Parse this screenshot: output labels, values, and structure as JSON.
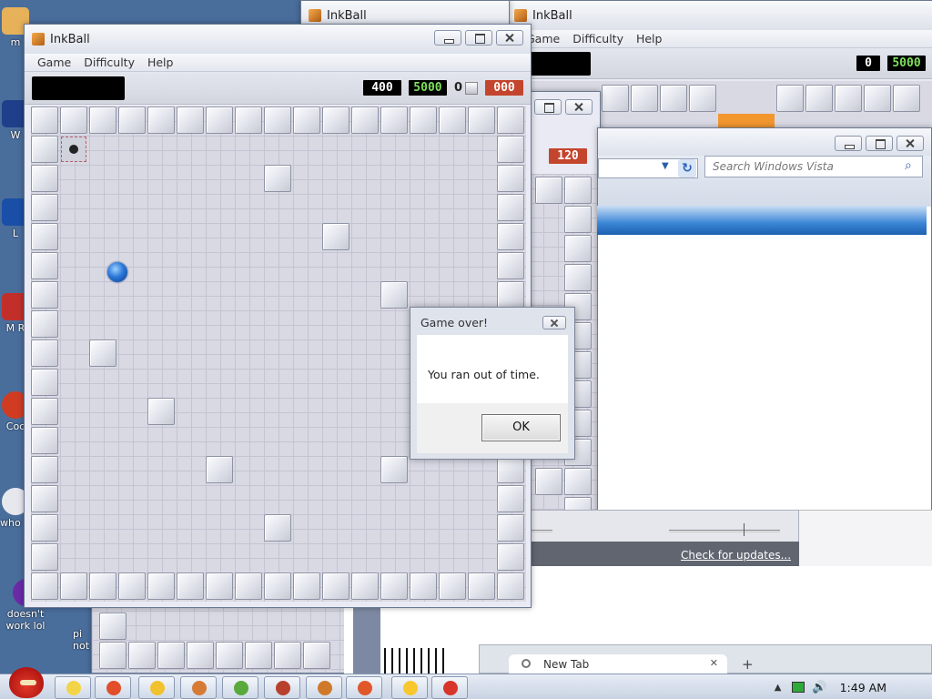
{
  "desktop": {
    "icons": [
      {
        "label": "m",
        "color": "#e7b15a"
      },
      {
        "label": "W",
        "color": "#1f3f8a"
      },
      {
        "label": "L",
        "color": "#1a4fa8"
      },
      {
        "label": "M R",
        "color": "#c22f2a"
      },
      {
        "label": "Coc",
        "color": "#d03c22"
      },
      {
        "label": "who us",
        "color": "#e7e7ee"
      },
      {
        "label": "doesn't work lol",
        "color": "#6b2aa8"
      }
    ],
    "partial_text_behind": "pi not"
  },
  "back_window_right": {
    "title": "InkBall",
    "menu": [
      "Game",
      "Difficulty",
      "Help"
    ],
    "score_left": "0",
    "score_right": "5000"
  },
  "back_window_mid": {
    "title": "InkBall",
    "timer": "120"
  },
  "browser_window": {
    "search_placeholder": "Search Windows Vista",
    "link_text": "Check for updates..."
  },
  "new_tab": {
    "label": "New Tab",
    "close_glyph": "✕",
    "plus_glyph": "+"
  },
  "inkball": {
    "title": "InkBall",
    "menu": [
      "Game",
      "Difficulty",
      "Help"
    ],
    "scores": {
      "current": "400",
      "target": "5000",
      "balls_count": "0",
      "timer": "000"
    },
    "colors": {
      "score_green": "#7de05b",
      "timer_red": "#c4452d",
      "ball_blue": "#2b78d8"
    }
  },
  "dialog": {
    "title": "Game over!",
    "message": "You ran out of time.",
    "ok_label": "OK"
  },
  "taskbar": {
    "clock": "1:49 AM",
    "buttons": [
      {
        "name": "angry-birds-icon",
        "color": "#f3d448"
      },
      {
        "name": "chrome-icon",
        "color": "#e24d2a"
      },
      {
        "name": "sun-game-icon",
        "color": "#f2c12e"
      },
      {
        "name": "paint-icon",
        "color": "#d67b36"
      },
      {
        "name": "frog-game-icon",
        "color": "#59a93c"
      },
      {
        "name": "flag-app-icon",
        "color": "#b8412b"
      },
      {
        "name": "inkball-icon",
        "color": "#cf7a2b"
      },
      {
        "name": "firefox-icon",
        "color": "#e0572a"
      },
      {
        "name": "smiley-icon",
        "color": "#f7c72d"
      },
      {
        "name": "flash-icon",
        "color": "#d8362a"
      }
    ]
  }
}
